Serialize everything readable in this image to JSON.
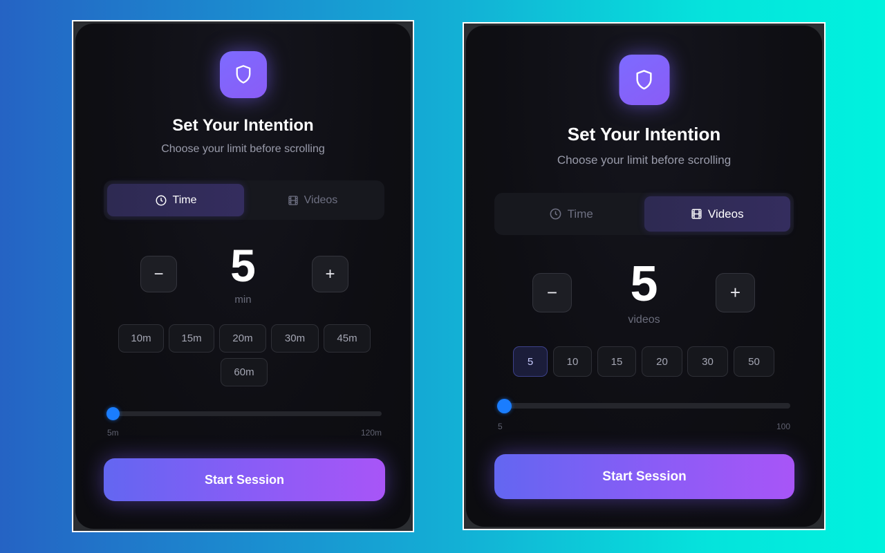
{
  "panels": [
    {
      "title": "Set Your Intention",
      "subtitle": "Choose your limit before scrolling",
      "tabs": [
        {
          "label": "Time",
          "icon": "clock-icon",
          "active": true
        },
        {
          "label": "Videos",
          "icon": "film-icon",
          "active": false
        }
      ],
      "decrement_label": "−",
      "increment_label": "+",
      "value": "5",
      "unit": "min",
      "presets": [
        "10m",
        "15m",
        "20m",
        "30m",
        "45m",
        "60m"
      ],
      "slider": {
        "min_label": "5m",
        "max_label": "120m",
        "min": 5,
        "max": 120,
        "value": 5
      },
      "start_label": "Start Session"
    },
    {
      "title": "Set Your Intention",
      "subtitle": "Choose your limit before scrolling",
      "tabs": [
        {
          "label": "Time",
          "icon": "clock-icon",
          "active": false
        },
        {
          "label": "Videos",
          "icon": "film-icon",
          "active": true
        }
      ],
      "decrement_label": "−",
      "increment_label": "+",
      "value": "5",
      "unit": "videos",
      "presets": [
        "5",
        "10",
        "15",
        "20",
        "30",
        "50"
      ],
      "selected_preset": "5",
      "slider": {
        "min_label": "5",
        "max_label": "100",
        "min": 5,
        "max": 100,
        "value": 5
      },
      "start_label": "Start Session"
    }
  ],
  "colors": {
    "accent": "#8b5cf6",
    "slider_thumb": "#1a7dff",
    "card_bg": "#0e0e13"
  }
}
